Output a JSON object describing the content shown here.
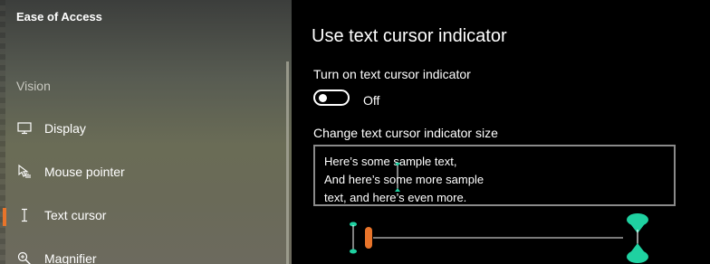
{
  "sidebar": {
    "title": "Ease of Access",
    "section": "Vision",
    "items": [
      {
        "label": "Display",
        "icon": "display-icon"
      },
      {
        "label": "Mouse pointer",
        "icon": "mouse-pointer-icon"
      },
      {
        "label": "Text cursor",
        "icon": "text-cursor-icon",
        "selected": true
      },
      {
        "label": "Magnifier",
        "icon": "magnifier-icon"
      }
    ]
  },
  "main": {
    "title": "Use text cursor indicator",
    "toggle": {
      "label": "Turn on text cursor indicator",
      "state": "Off"
    },
    "size": {
      "label": "Change text cursor indicator size",
      "sample_lines": [
        "Here’s some sample text,",
        "And here’s some more sample",
        "text, and here’s even more."
      ],
      "slider_value": 0
    }
  },
  "colors": {
    "accent": "#e8742a",
    "indicator": "#1fd1a1",
    "background": "#000000"
  }
}
